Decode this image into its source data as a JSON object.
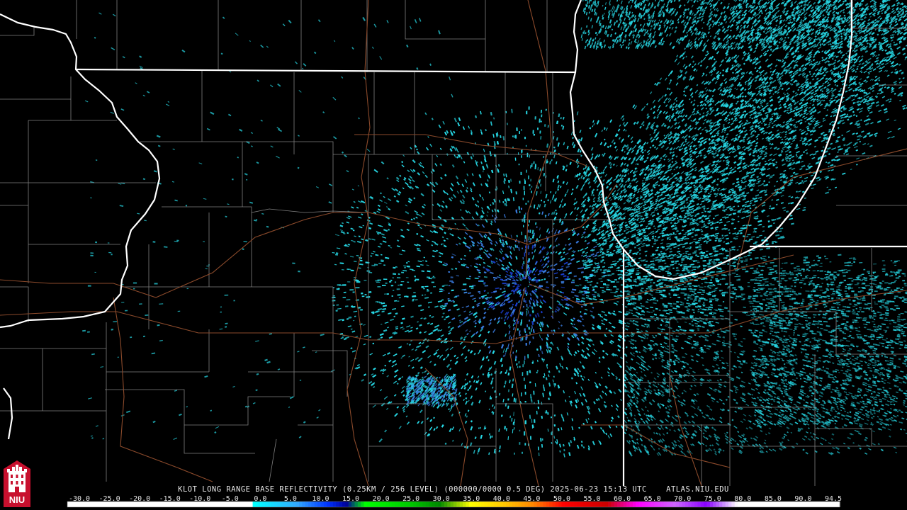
{
  "caption": {
    "product": "KLOT LONG RANGE BASE REFLECTIVITY (0.25KM / 256 LEVEL) (000000/0000 0.5 DEG) 2025-06-23 15:13 UTC",
    "source": "ATLAS.NIU.EDU"
  },
  "logo": {
    "text": "NIU",
    "color": "#c8102e"
  },
  "legend": {
    "ticks": [
      "-30.0",
      "-25.0",
      "-20.0",
      "-15.0",
      "-10.0",
      "-5.0",
      "0.0",
      "5.0",
      "10.0",
      "15.0",
      "20.0",
      "25.0",
      "30.0",
      "35.0",
      "40.0",
      "45.0",
      "50.0",
      "55.0",
      "60.0",
      "65.0",
      "70.0",
      "75.0",
      "80.0",
      "85.0",
      "90.0",
      "94.5"
    ],
    "stops": [
      {
        "dbz": -30,
        "color": "#ffffff"
      },
      {
        "dbz": 0,
        "color": "#ffffff"
      },
      {
        "dbz": 0.1,
        "color": "#00ffff"
      },
      {
        "dbz": 7,
        "color": "#33aaff"
      },
      {
        "dbz": 12,
        "color": "#0033ff"
      },
      {
        "dbz": 15,
        "color": "#000099"
      },
      {
        "dbz": 18,
        "color": "#00ff00"
      },
      {
        "dbz": 25,
        "color": "#00cc00"
      },
      {
        "dbz": 30,
        "color": "#008800"
      },
      {
        "dbz": 35,
        "color": "#ffff00"
      },
      {
        "dbz": 40,
        "color": "#ffcc00"
      },
      {
        "dbz": 45,
        "color": "#ff8800"
      },
      {
        "dbz": 50,
        "color": "#ff0000"
      },
      {
        "dbz": 57,
        "color": "#cc0000"
      },
      {
        "dbz": 62,
        "color": "#ff00ff"
      },
      {
        "dbz": 68,
        "color": "#cc66ff"
      },
      {
        "dbz": 73,
        "color": "#8800ff"
      },
      {
        "dbz": 78,
        "color": "#ffffff"
      },
      {
        "dbz": 94.5,
        "color": "#ffffff"
      }
    ]
  },
  "colors": {
    "state_border": "#ffffff",
    "county_border": "#808080",
    "highway": "#8b4a2b",
    "echo_light": "#27d9e6",
    "echo_blue": "#3a7ce0",
    "echo_dark_blue": "#1b3fd0",
    "radar_site": "#000000"
  }
}
